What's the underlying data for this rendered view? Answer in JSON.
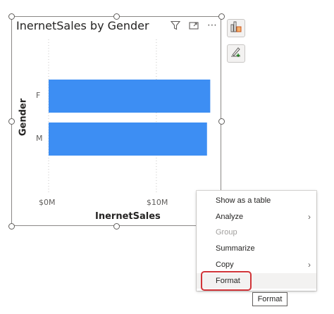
{
  "visual": {
    "title": "InernetSales by Gender",
    "icons": [
      "filter-icon",
      "focus-mode-icon",
      "more-options-icon"
    ],
    "more_glyph": "⋯"
  },
  "chart_data": {
    "type": "bar",
    "orientation": "horizontal",
    "categories": [
      "F",
      "M"
    ],
    "values": [
      15.0,
      14.7
    ],
    "xlabel": "InernetSales",
    "ylabel": "Gender",
    "xlim": [
      0,
      15.5
    ],
    "ticks": [
      {
        "value": 0,
        "label": "$0M"
      },
      {
        "value": 10,
        "label": "$10M"
      }
    ],
    "grid": true,
    "bar_color": "#3d8ef3"
  },
  "side_buttons": [
    "build-visual-icon",
    "format-visual-icon"
  ],
  "context_menu": {
    "items": [
      {
        "label": "Show as a table",
        "disabled": false,
        "submenu": false
      },
      {
        "label": "Analyze",
        "disabled": false,
        "submenu": true
      },
      {
        "label": "Group",
        "disabled": true,
        "submenu": false
      },
      {
        "label": "Summarize",
        "disabled": false,
        "submenu": false
      },
      {
        "label": "Copy",
        "disabled": false,
        "submenu": true
      },
      {
        "label": "Format",
        "disabled": false,
        "submenu": false,
        "hovered": true
      }
    ],
    "chevron": "›"
  },
  "tooltip": {
    "text": "Format"
  },
  "colors": {
    "highlight": "#d13438",
    "bar": "#3d8ef3"
  }
}
